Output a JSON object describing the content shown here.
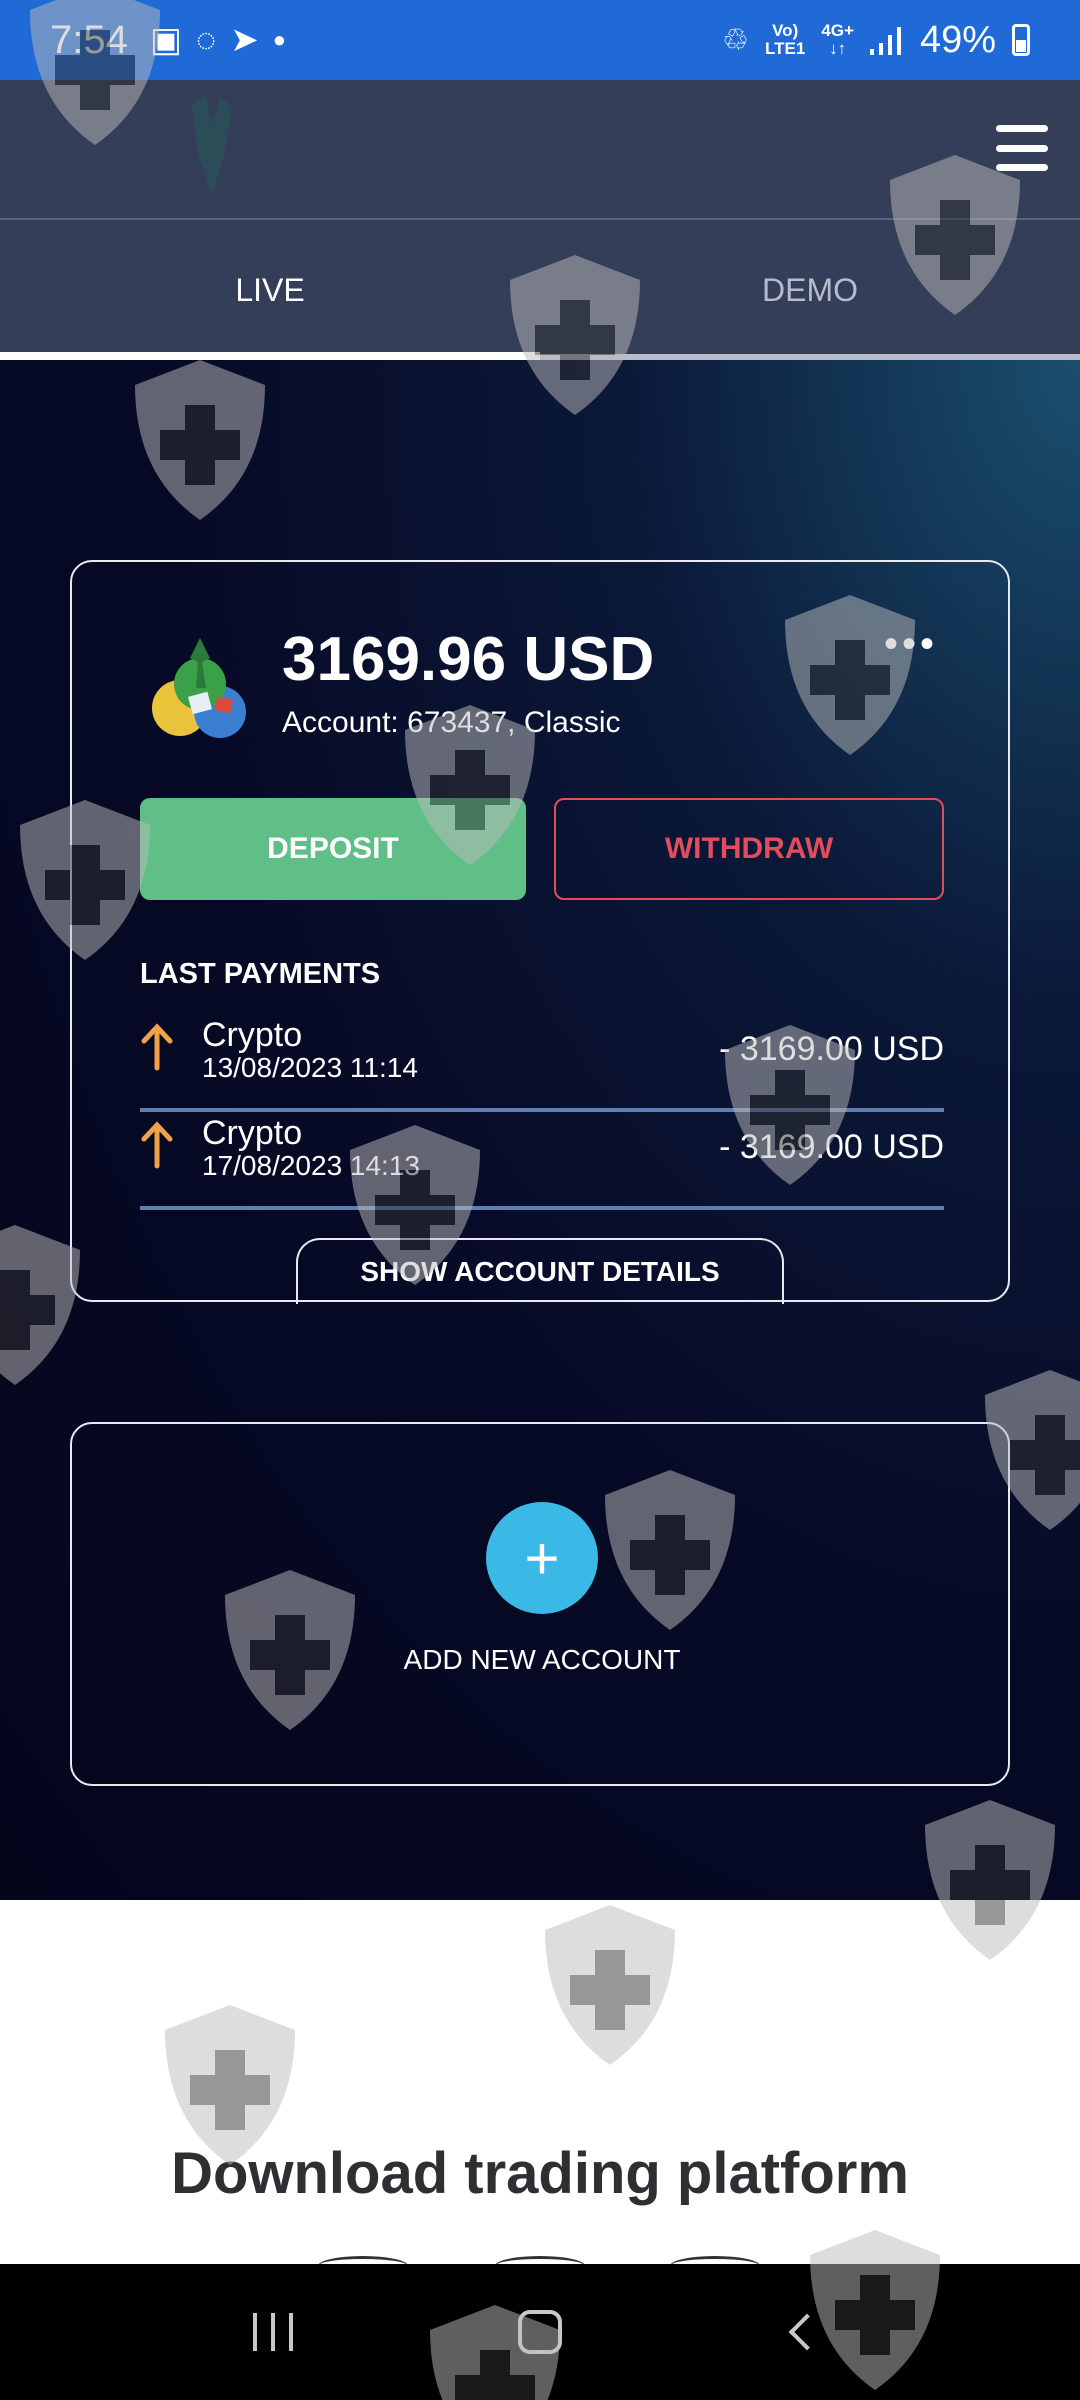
{
  "status_bar": {
    "time": "7:54",
    "network_line1": "Vo)",
    "network_line2": "LTE1",
    "signal_label": "4G+",
    "battery": "49%"
  },
  "tabs": [
    {
      "label": "LIVE",
      "active": true
    },
    {
      "label": "DEMO",
      "active": false
    }
  ],
  "account_card": {
    "balance": "3169.96 USD",
    "account_label": "Account:",
    "account_value": "673437, Classic",
    "more_icon": "•••",
    "deposit_label": "DEPOSIT",
    "withdraw_label": "WITHDRAW",
    "last_payments_title": "LAST PAYMENTS",
    "payments": [
      {
        "name": "Crypto",
        "date": "13/08/2023 11:14",
        "amount": "- 3169.00 USD"
      },
      {
        "name": "Crypto",
        "date": "17/08/2023 14:13",
        "amount": "- 3169.00 USD"
      }
    ],
    "details_label": "SHOW ACCOUNT DETAILS"
  },
  "add_account": {
    "plus": "+",
    "label": "ADD NEW ACCOUNT"
  },
  "download": {
    "title": "Download trading platform"
  },
  "colors": {
    "status_bar": "#1f6ad6",
    "header": "#353e58",
    "deposit": "#5fbf86",
    "withdraw": "#e24c5c",
    "accent": "#3ab9e6",
    "arrow": "#f0a24a"
  }
}
